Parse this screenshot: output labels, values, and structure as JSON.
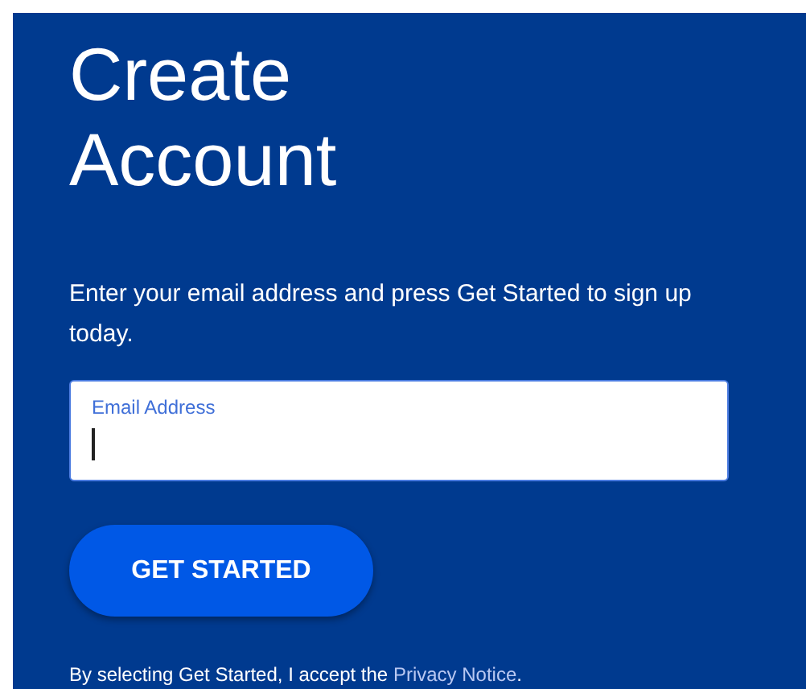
{
  "title": "Create Account",
  "description": "Enter your email address and press Get Started to sign up today.",
  "email_field": {
    "label": "Email Address",
    "focused": true
  },
  "button": {
    "label": "GET STARTED"
  },
  "footer": {
    "text": "By selecting Get Started, I accept the ",
    "link": "Privacy Notice",
    "end": "."
  }
}
